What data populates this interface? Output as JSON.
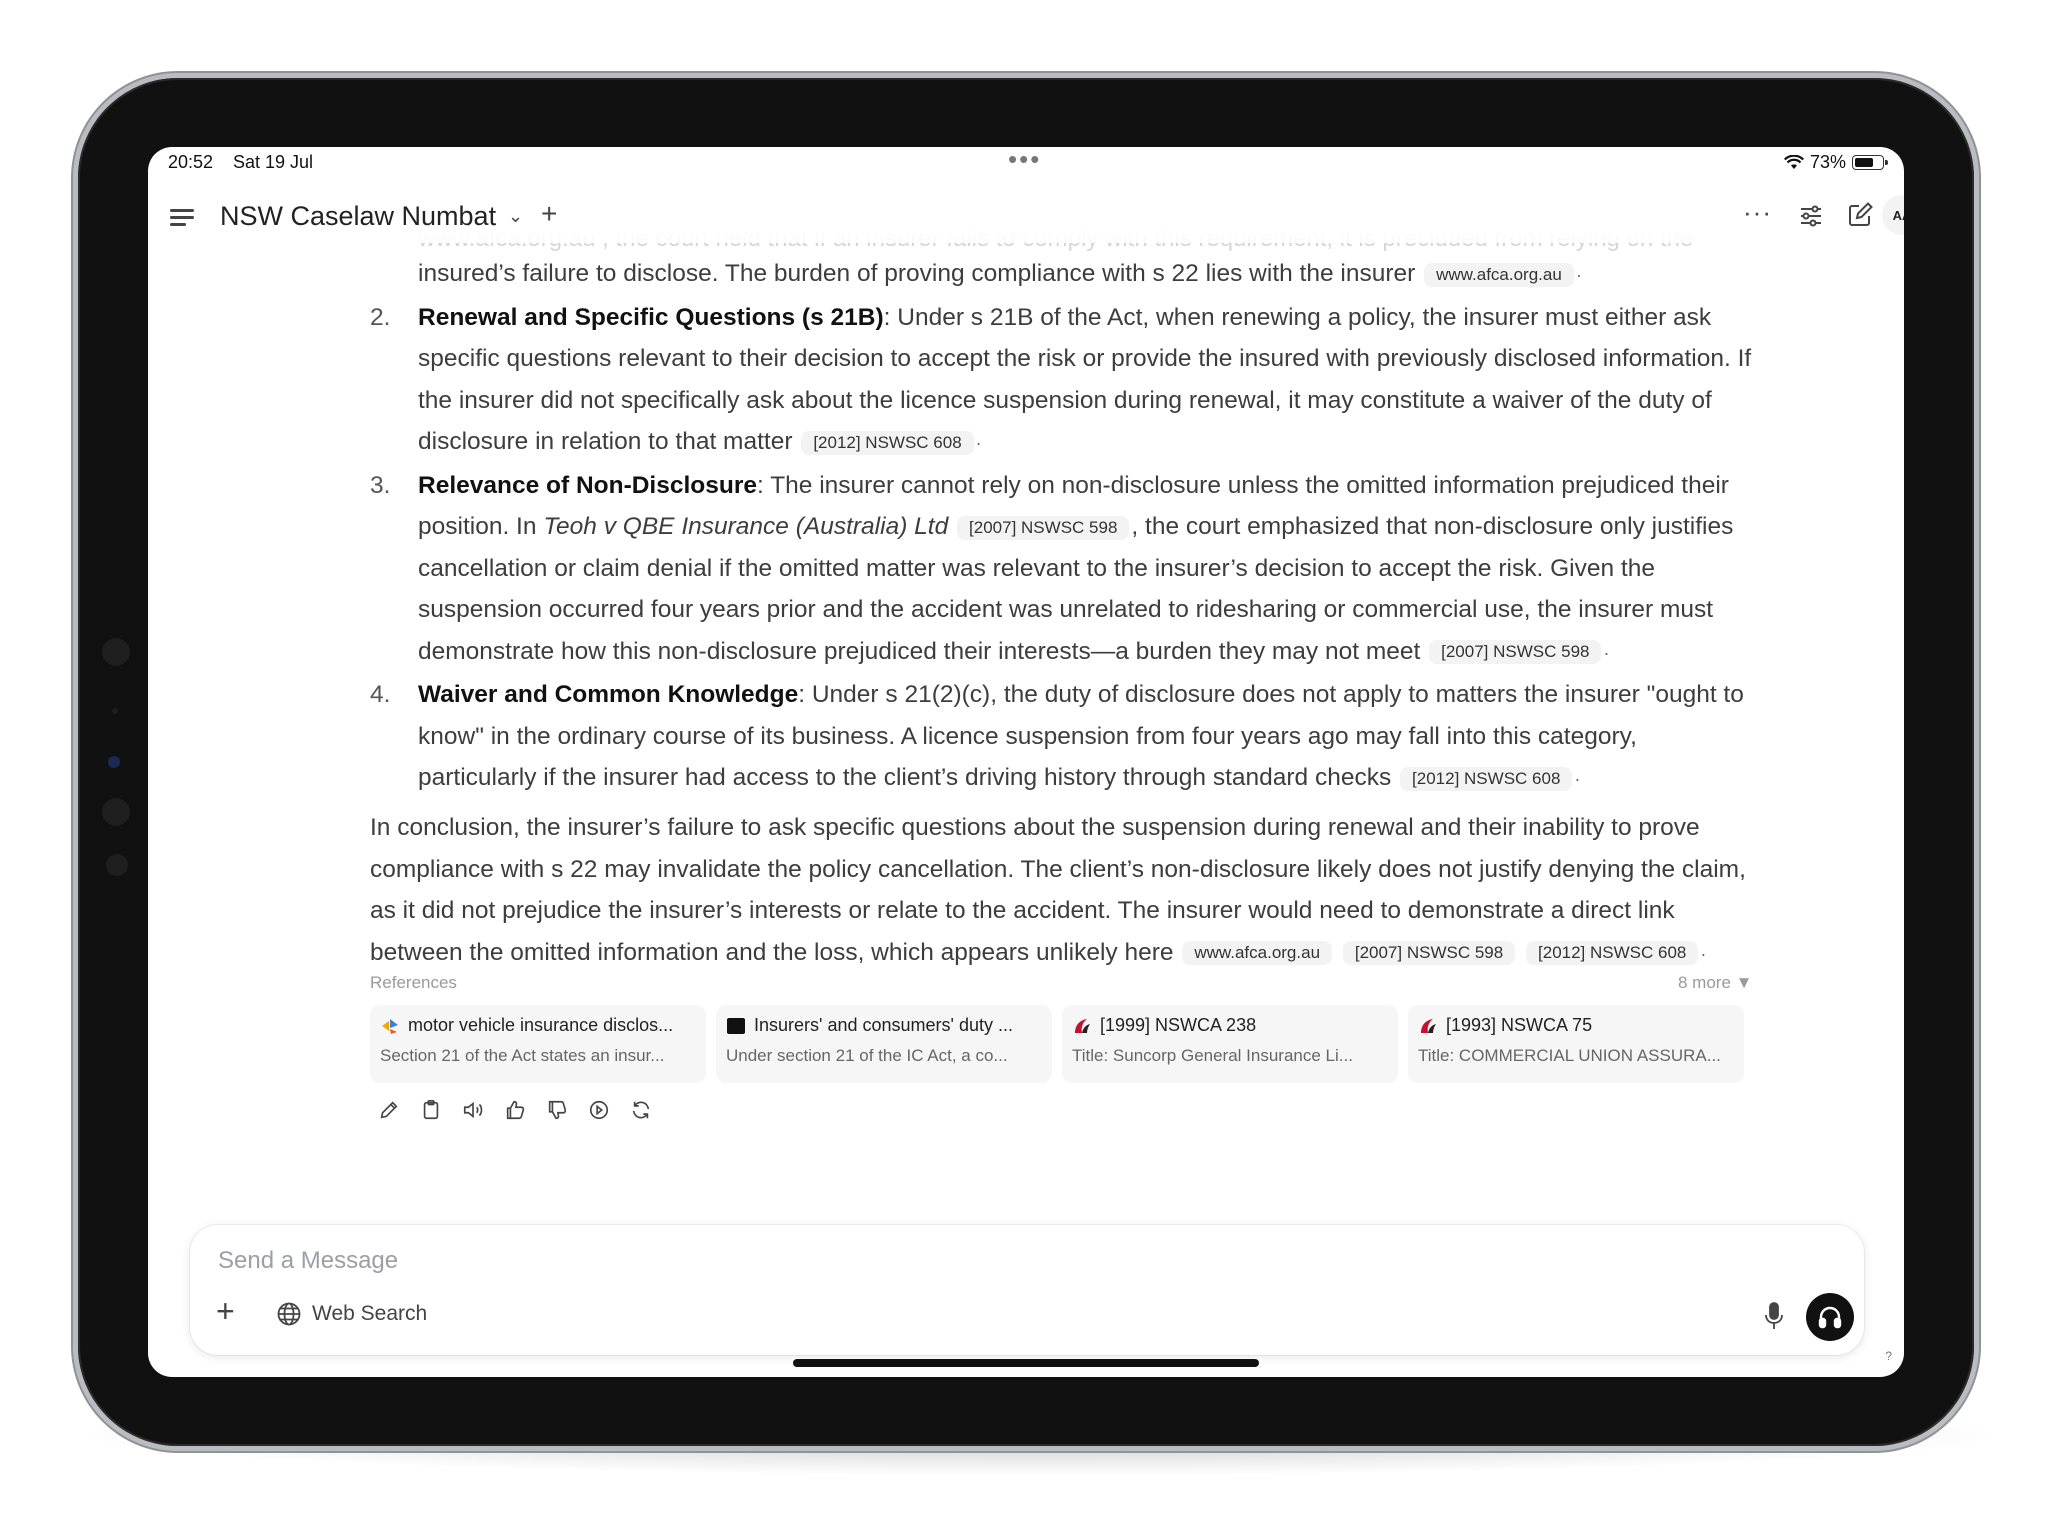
{
  "status_bar": {
    "time": "20:52",
    "date": "Sat 19 Jul",
    "battery": "73%",
    "battery_level": 0.73
  },
  "header": {
    "title": "NSW Caselaw Numbat",
    "avatar": "AA",
    "icons": [
      "menu-icon",
      "chevron-down-icon",
      "plus-icon",
      "more-icon",
      "sliders-icon",
      "edit-icon"
    ]
  },
  "message": {
    "faded_line": "www.afca.org.au , the court held that if an insurer fails to comply with this requirement, it is precluded from relying on the",
    "intro_tail": "insured’s failure to disclose. The burden of proving compliance with s 22 lies with the insurer",
    "intro_cite": "www.afca.org.au",
    "items": [
      {
        "num": "2.",
        "head": "Renewal and Specific Questions (s 21B)",
        "text": ": Under s 21B of the Act, when renewing a policy, the insurer must either ask specific questions relevant to their decision to accept the risk or provide the insured with previously disclosed information. If the insurer did not specifically ask about the licence suspension during renewal, it may constitute a waiver of the duty of disclosure in relation to that matter",
        "cite": "[2012] NSWSC 608"
      },
      {
        "num": "3.",
        "head": "Relevance of Non-Disclosure",
        "text_a": ": The insurer cannot rely on non-disclosure unless the omitted information prejudiced their position. In ",
        "case_name": "Teoh v QBE Insurance (Australia) Ltd",
        "cite_mid": "[2007] NSWSC 598",
        "text_b": ", the court emphasized that non-disclosure only justifies cancellation or claim denial if the omitted matter was relevant to the insurer’s decision to accept the risk. Given the suspension occurred four years prior and the accident was unrelated to ridesharing or commercial use, the insurer must demonstrate how this non-disclosure prejudiced their interests—a burden they may not meet",
        "cite": "[2007] NSWSC 598"
      },
      {
        "num": "4.",
        "head": "Waiver and Common Knowledge",
        "text": ": Under s 21(2)(c), the duty of disclosure does not apply to matters the insurer \"ought to know\" in the ordinary course of its business. A licence suspension from four years ago may fall into this category, particularly if the insurer had access to the client’s driving history through standard checks",
        "cite": "[2012] NSWSC 608"
      }
    ],
    "conclusion": "In conclusion, the insurer’s failure to ask specific questions about the suspension during renewal and their inability to prove compliance with s 22 may invalidate the policy cancellation. The client’s non-disclosure likely does not justify denying the claim, as it did not prejudice the insurer’s interests or relate to the accident. The insurer would need to demonstrate a direct link between the omitted information and the loss, which appears unlikely here",
    "conclusion_cites": [
      "www.afca.org.au",
      "[2007] NSWSC 598",
      "[2012] NSWSC 608"
    ]
  },
  "references": {
    "label": "References",
    "more": "8 more ▼",
    "cards": [
      {
        "title": "motor vehicle insurance disclos...",
        "snippet": "Section 21 of the Act states an insur...",
        "icon": "afca-icon"
      },
      {
        "title": "Insurers' and consumers' duty ...",
        "snippet": "Under section 21 of the IC Act, a co...",
        "icon": "black-square-icon"
      },
      {
        "title": "[1999] NSWCA 238",
        "snippet": "Title: Suncorp General Insurance Li...",
        "icon": "caselaw-icon"
      },
      {
        "title": "[1993] NSWCA 75",
        "snippet": "Title: COMMERCIAL UNION ASSURA...",
        "icon": "caselaw-icon"
      }
    ]
  },
  "actions": [
    "edit-icon",
    "copy-icon",
    "read-aloud-icon",
    "thumbs-up-icon",
    "thumbs-down-icon",
    "continue-icon",
    "regenerate-icon"
  ],
  "composer": {
    "placeholder": "Send a Message",
    "web_search_label": "Web Search"
  },
  "help": "?"
}
